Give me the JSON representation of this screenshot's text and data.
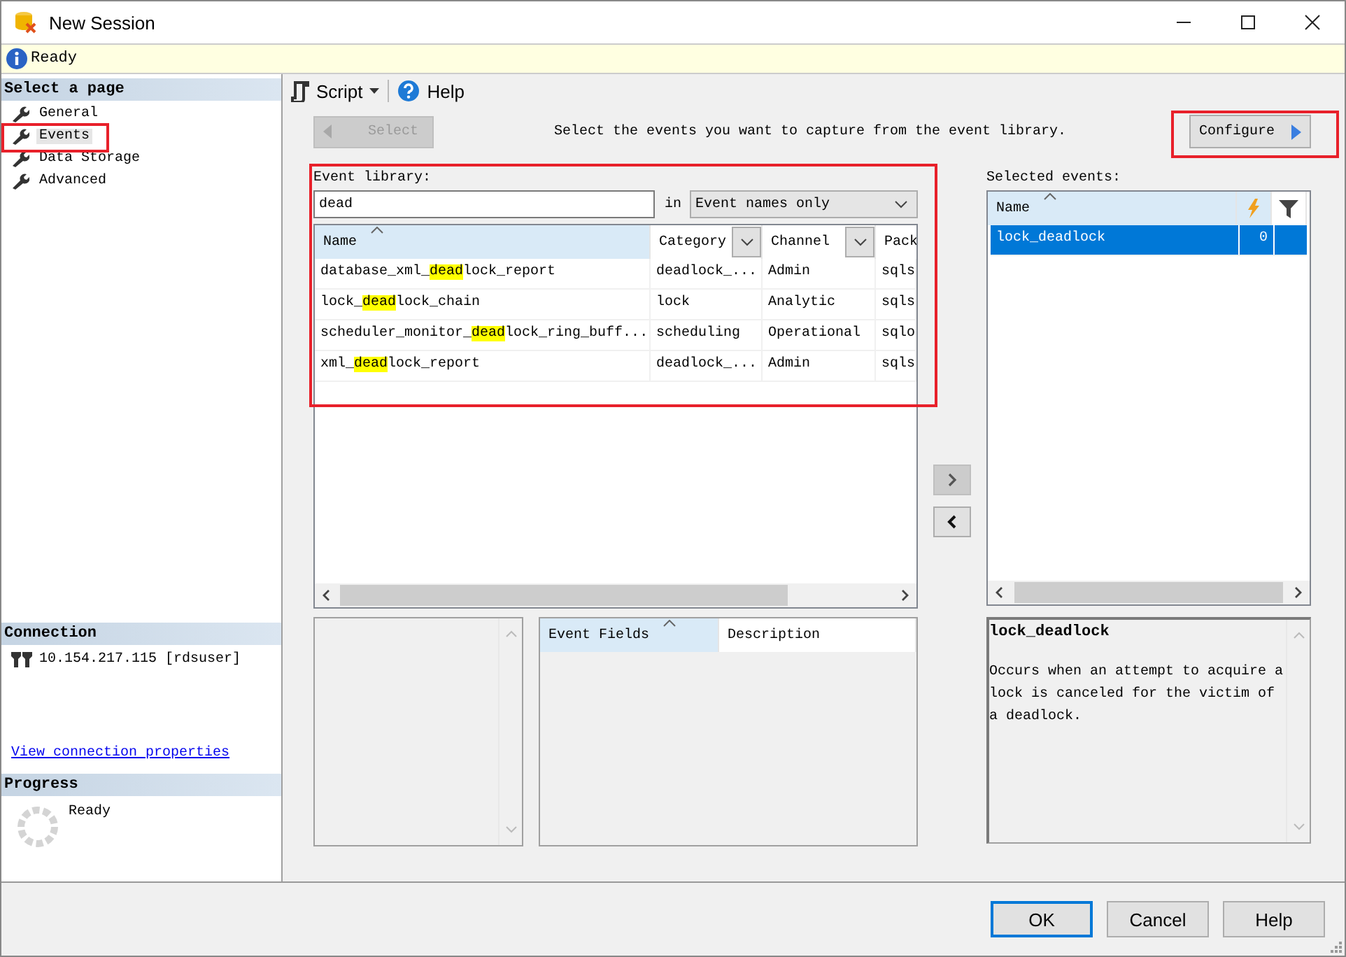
{
  "window": {
    "title": "New Session"
  },
  "info_bar": {
    "message": "Ready"
  },
  "sidebar": {
    "heading": "Select a page",
    "items": [
      {
        "label": "General",
        "selected": false
      },
      {
        "label": "Events",
        "selected": true
      },
      {
        "label": "Data Storage",
        "selected": false
      },
      {
        "label": "Advanced",
        "selected": false
      }
    ],
    "connection": {
      "heading": "Connection",
      "server": "10.154.217.115 [rdsuser]",
      "link": "View connection properties"
    },
    "progress": {
      "heading": "Progress",
      "status": "Ready"
    }
  },
  "toolbar": {
    "script": "Script",
    "help": "Help"
  },
  "select_button": {
    "label": "Select",
    "disabled": true
  },
  "instruction": "Select the events you want to capture from the event library.",
  "configure_button": {
    "label": "Configure"
  },
  "event_library": {
    "label": "Event library:",
    "search": "dead",
    "in_label": "in",
    "scope": "Event names only",
    "columns": [
      {
        "label": "Name",
        "sorted": true,
        "filter": false
      },
      {
        "label": "Category",
        "sorted": false,
        "filter": true
      },
      {
        "label": "Channel",
        "sorted": false,
        "filter": true
      },
      {
        "label": "Pack",
        "sorted": false,
        "filter": false
      }
    ],
    "rows": [
      {
        "name": {
          "before": "database_xml_",
          "match": "dead",
          "after": "lock_report"
        },
        "category": "deadlock_...",
        "channel": "Admin",
        "package": "sqls"
      },
      {
        "name": {
          "before": "lock_",
          "match": "dead",
          "after": "lock_chain"
        },
        "category": "lock",
        "channel": "Analytic",
        "package": "sqls"
      },
      {
        "name": {
          "before": "scheduler_monitor_",
          "match": "dead",
          "after": "lock_ring_buff..."
        },
        "category": "scheduling",
        "channel": "Operational",
        "package": "sqlo"
      },
      {
        "name": {
          "before": "xml_",
          "match": "dead",
          "after": "lock_report"
        },
        "category": "deadlock_...",
        "channel": "Admin",
        "package": "sqls"
      }
    ]
  },
  "selected_events": {
    "label": "Selected events:",
    "column": "Name",
    "rows": [
      {
        "name": "lock_deadlock",
        "count": "0",
        "selected": true
      }
    ]
  },
  "event_fields": {
    "columns": [
      {
        "label": "Event Fields",
        "sorted": true
      },
      {
        "label": "Description",
        "sorted": false
      }
    ]
  },
  "description": {
    "title": "lock_deadlock",
    "text": "Occurs when an attempt to acquire a lock is canceled for the victim of a deadlock."
  },
  "buttons": [
    {
      "label": "OK",
      "default": true
    },
    {
      "label": "Cancel",
      "default": false
    },
    {
      "label": "Help",
      "default": false
    }
  ]
}
